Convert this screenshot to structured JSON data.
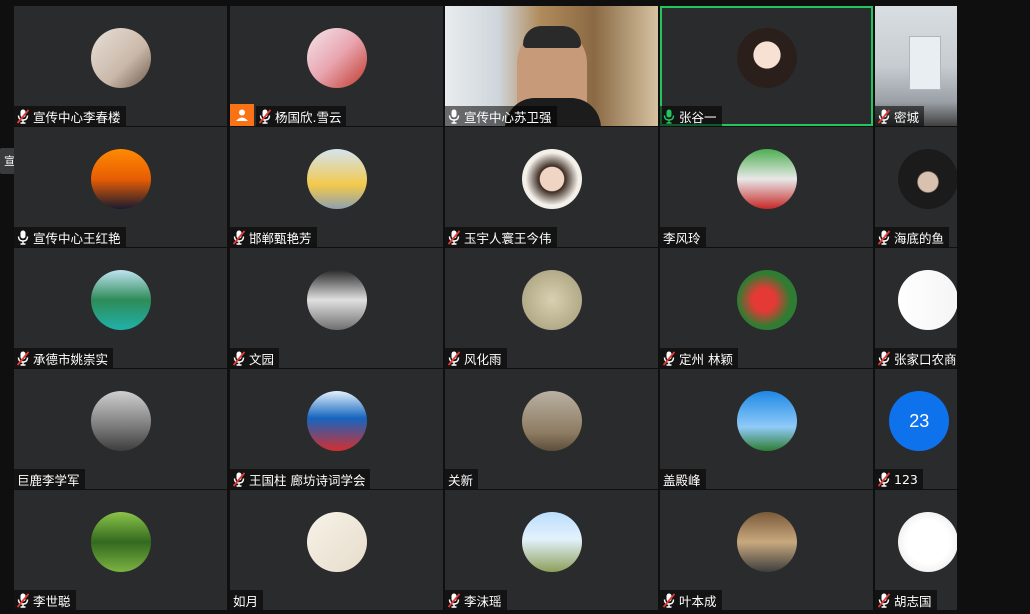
{
  "colors": {
    "tile_bg": "#2a2b2d",
    "active_speaker_border": "#22c55e",
    "unmuted_mic": "#22c55e",
    "user_badge": "#f97316",
    "number_avatar": "#0e72ed"
  },
  "floating_tab": {
    "label": "宣传中..."
  },
  "participants": [
    {
      "name": "宣传中心李春楼",
      "mic": "muted",
      "avatar": "photo-woman-fan"
    },
    {
      "name": "杨国欣.雪云",
      "mic": "muted",
      "avatar": "photo-woman-red",
      "badge": "user-icon"
    },
    {
      "name": "宣传中心苏卫强",
      "mic": "on",
      "avatar": "video-man-bookshelf"
    },
    {
      "name": "张谷一",
      "mic": "on-green",
      "avatar": "photo-woman-portrait",
      "active": true
    },
    {
      "name": "密城",
      "mic": "muted",
      "avatar": "video-room"
    },
    {
      "name": "宣传中心王红艳",
      "mic": "on",
      "avatar": "photo-sunset"
    },
    {
      "name": "邯郸甄艳芳",
      "mic": "muted",
      "avatar": "photo-woman-yellow"
    },
    {
      "name": "玉宇人寰王今伟",
      "mic": "muted",
      "avatar": "photo-woman-longhair"
    },
    {
      "name": "李风玲",
      "mic": "none",
      "avatar": "photo-kids-sign"
    },
    {
      "name": "海底的鱼",
      "mic": "muted",
      "avatar": "photo-dark-hair"
    },
    {
      "name": "承德市姚崇实",
      "mic": "muted",
      "avatar": "photo-lake"
    },
    {
      "name": "文园",
      "mic": "muted",
      "avatar": "photo-waterfall"
    },
    {
      "name": "风化雨",
      "mic": "muted",
      "avatar": "photo-sketch"
    },
    {
      "name": "定州 林颖",
      "mic": "muted",
      "avatar": "photo-flowers"
    },
    {
      "name": "张家口农商银行",
      "mic": "muted",
      "avatar": "photo-logo"
    },
    {
      "name": "巨鹿李学军",
      "mic": "none",
      "avatar": "photo-bridge"
    },
    {
      "name": "王国柱 廊坊诗词学会",
      "mic": "muted",
      "avatar": "photo-man-flags"
    },
    {
      "name": "关新",
      "mic": "none",
      "avatar": "photo-building"
    },
    {
      "name": "盖殿峰",
      "mic": "none",
      "avatar": "photo-sky"
    },
    {
      "name": "123",
      "mic": "muted",
      "avatar": "number",
      "number": "23"
    },
    {
      "name": "李世聪",
      "mic": "muted",
      "avatar": "photo-terraces"
    },
    {
      "name": "如月",
      "mic": "none",
      "avatar": "photo-painting"
    },
    {
      "name": "李沫瑶",
      "mic": "muted",
      "avatar": "photo-field"
    },
    {
      "name": "叶本成",
      "mic": "muted",
      "avatar": "photo-group"
    },
    {
      "name": "胡志国",
      "mic": "muted",
      "avatar": "photo-calligraphy"
    }
  ]
}
